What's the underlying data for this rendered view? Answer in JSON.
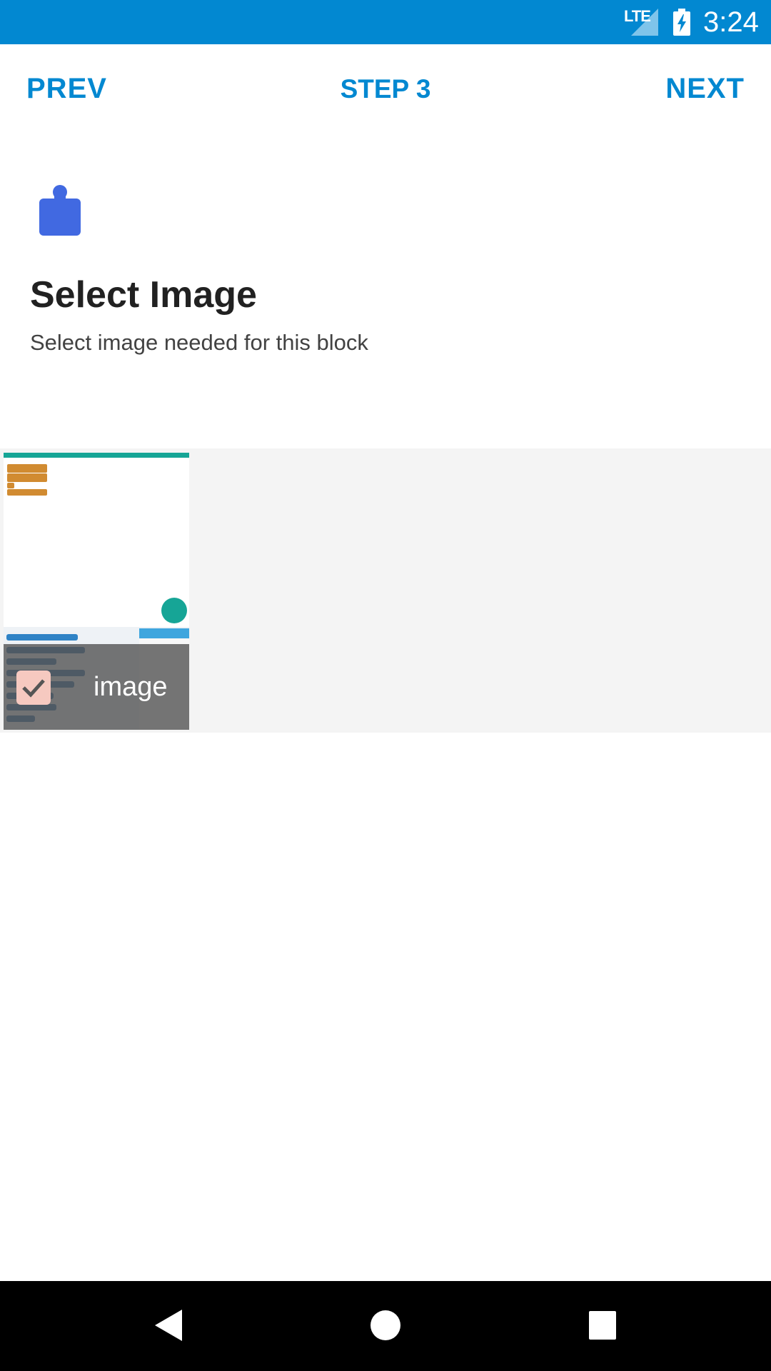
{
  "status_bar": {
    "network_label": "LTE",
    "time": "3:24",
    "background_color": "#0288d1"
  },
  "stepper": {
    "prev_label": "PREV",
    "step_label": "STEP 3",
    "next_label": "NEXT",
    "accent_color": "#0288d1"
  },
  "header": {
    "icon": "puzzle-piece-icon",
    "icon_color": "#4169e1",
    "title": "Select Image",
    "subtitle": "Select image needed for this block"
  },
  "image_grid": {
    "items": [
      {
        "label": "image",
        "selected": true,
        "thumbnail": "blocks-editor-screenshot"
      }
    ]
  },
  "nav_bar": {
    "back_icon": "back-triangle-icon",
    "home_icon": "home-circle-icon",
    "recents_icon": "recents-square-icon"
  }
}
